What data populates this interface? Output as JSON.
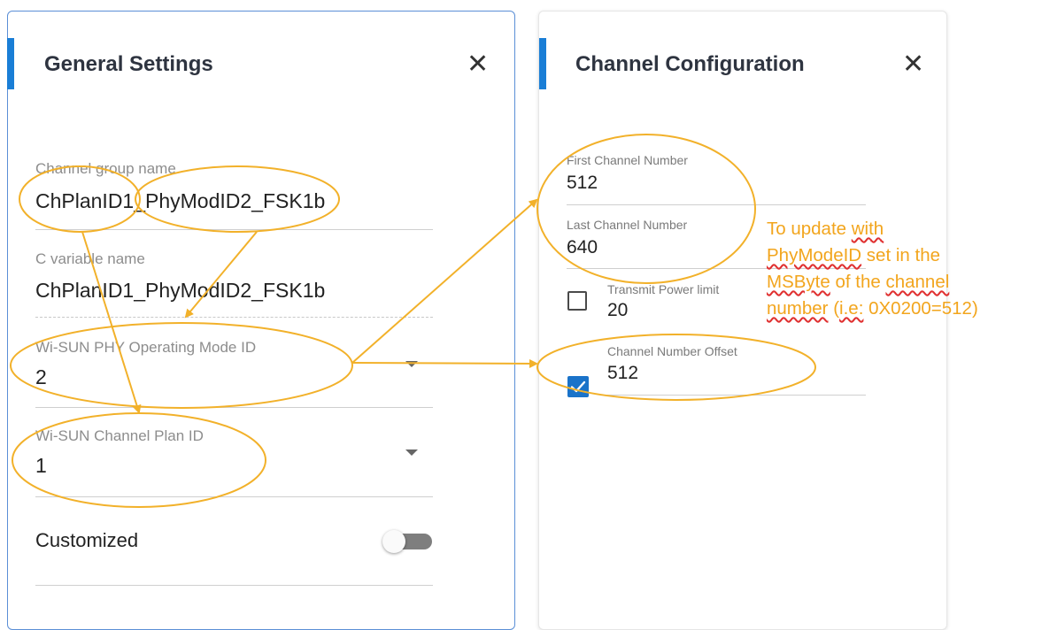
{
  "general_settings": {
    "title": "General Settings",
    "close_icon": "close-icon",
    "fields": {
      "channel_group_name": {
        "label": "Channel group name",
        "value": "ChPlanID1_PhyModID2_FSK1b"
      },
      "c_variable_name": {
        "label": "C variable name",
        "value": "ChPlanID1_PhyModID2_FSK1b"
      },
      "phy_operating_mode": {
        "label": "Wi-SUN PHY Operating Mode ID",
        "value": "2"
      },
      "channel_plan_id": {
        "label": "Wi-SUN Channel Plan ID",
        "value": "1"
      }
    },
    "customized": {
      "label": "Customized",
      "enabled": false
    }
  },
  "channel_configuration": {
    "title": "Channel Configuration",
    "close_icon": "close-icon",
    "fields": {
      "first_channel": {
        "label": "First Channel Number",
        "value": "512"
      },
      "last_channel": {
        "label": "Last Channel Number",
        "value": "640"
      },
      "transmit_power_limit": {
        "label": "Transmit Power limit",
        "value": "20",
        "checked": false
      },
      "channel_number_offset": {
        "label": "Channel Number Offset",
        "value": "512",
        "checked": true
      }
    }
  },
  "annotation": {
    "line1_a": "To update ",
    "line1_b": "with",
    "line2_a": "PhyModeID",
    "line2_b": " set in the",
    "line3_a": "MSByte",
    "line3_b": " of the ",
    "line3_c": "channel",
    "line4_a": "number",
    "line4_b": " (",
    "line4_c": "i.e:",
    "line4_d": " 0X0200=512)"
  },
  "colors": {
    "accent": "#1a7ed6",
    "annotation": "#f2a51d",
    "checkbox": "#1a73c9"
  }
}
